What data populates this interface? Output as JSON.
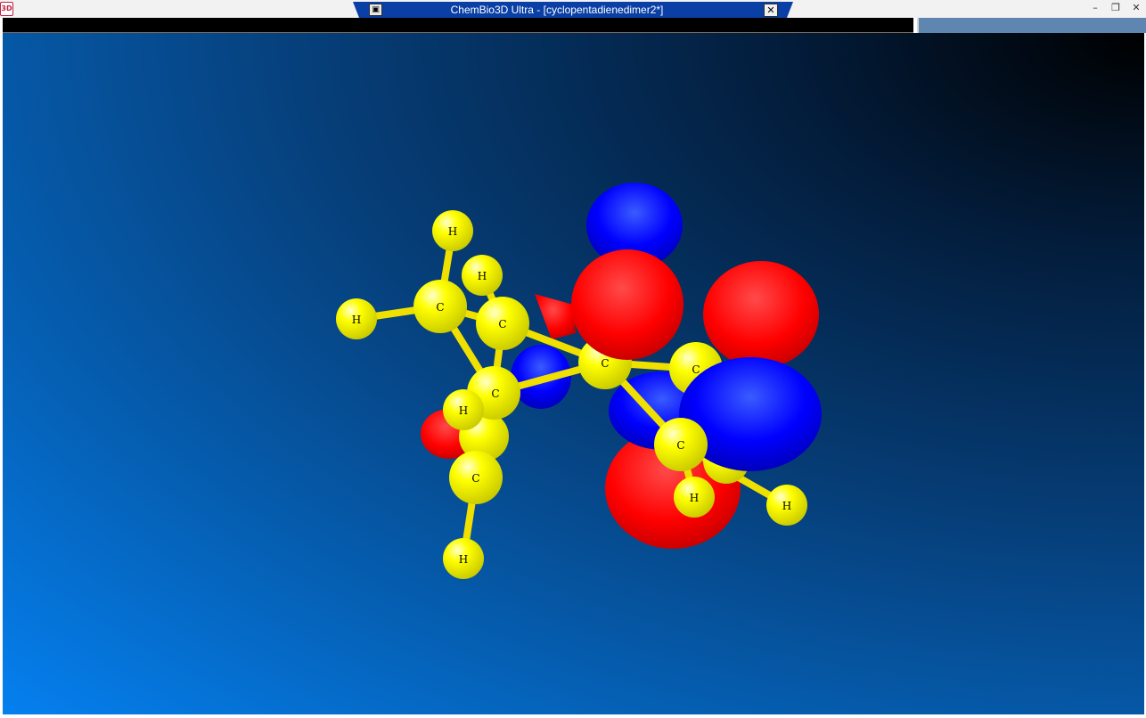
{
  "window": {
    "app_icon": "3D",
    "title": "ChemBio3D Ultra - [cyclopentadienedimer2*]",
    "tab_icon": "document-icon",
    "close_glyph": "✕",
    "controls": {
      "minimize": "–",
      "restore": "❐",
      "close": "✕"
    }
  },
  "colors": {
    "atom": "#ffff00",
    "bond": "#f0e000",
    "orbital_positive": "#ff0000",
    "orbital_negative": "#0000ff",
    "background_light": "#0580f0",
    "background_dark": "#000000"
  },
  "model": {
    "name": "cyclopentadienedimer2",
    "atom_labels": [
      "H",
      "H",
      "H",
      "C",
      "C",
      "C",
      "C",
      "H",
      "C",
      "C",
      "C",
      "H",
      "H",
      "H"
    ]
  }
}
